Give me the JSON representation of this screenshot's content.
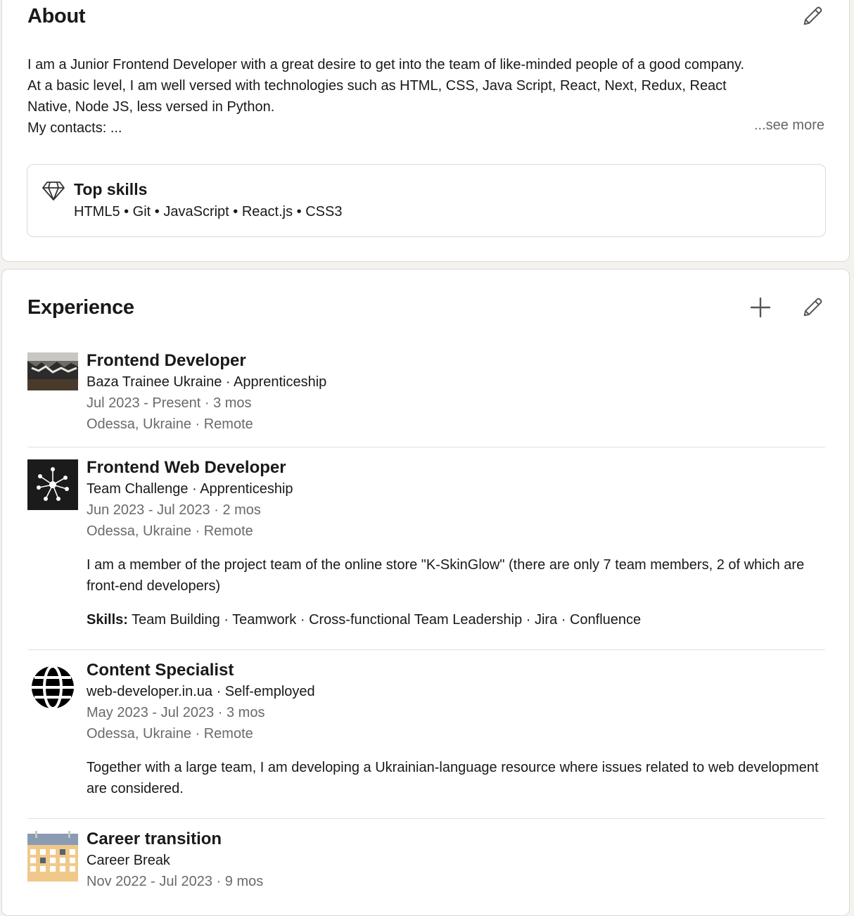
{
  "about": {
    "title": "About",
    "lines": [
      "I am a Junior Frontend Developer with a great desire to get into the team of like-minded people of a good company.",
      "At a basic level, I am well versed with technologies such as HTML, CSS, Java Script, React, Next, Redux, React",
      "Native, Node JS, less versed in Python.",
      "My contacts: ..."
    ],
    "see_more": "...see more",
    "top_skills": {
      "title": "Top skills",
      "list": "HTML5 • Git • JavaScript • React.js • CSS3",
      "icon": "diamond-icon"
    },
    "edit_icon": "pencil-icon"
  },
  "experience": {
    "title": "Experience",
    "add_icon": "plus-icon",
    "edit_icon": "pencil-icon",
    "items": [
      {
        "title": "Frontend Developer",
        "company": "Baza Trainee Ukraine · Apprenticeship",
        "dates": "Jul 2023 - Present · 3 mos",
        "location": "Odessa, Ukraine · Remote",
        "logo": "photo-logo"
      },
      {
        "title": "Frontend Web Developer",
        "company": "Team Challenge · Apprenticeship",
        "dates": "Jun 2023 - Jul 2023 · 2 mos",
        "location": "Odessa, Ukraine · Remote",
        "description": "I am a member of the project team of the online store \"K-SkinGlow\" (there are only 7 team members, 2 of which are front-end developers)",
        "skills_label": "Skills:",
        "skills": "Team Building · Teamwork · Cross-functional Team Leadership · Jira · Confluence",
        "logo": "network-node-logo"
      },
      {
        "title": "Content Specialist",
        "company": "web-developer.in.ua · Self-employed",
        "dates": "May 2023 - Jul 2023 · 3 mos",
        "location": "Odessa, Ukraine · Remote",
        "description": "Together with a large team, I am developing a Ukrainian-language resource where issues related to web development are considered.",
        "logo": "globe-logo"
      },
      {
        "title": "Career transition",
        "company": "Career Break",
        "dates": "Nov 2022 - Jul 2023 · 9 mos",
        "logo": "calendar-logo"
      }
    ]
  },
  "colors": {
    "page_bg": "#f4f2ee",
    "card_bg": "#ffffff",
    "text": "#191919",
    "muted": "#6a6a6a",
    "border": "#dcdad6"
  }
}
